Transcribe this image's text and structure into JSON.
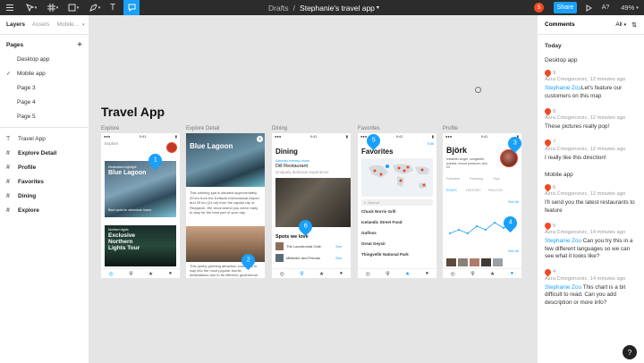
{
  "toolbar": {
    "breadcrumb_parent": "Drafts",
    "breadcrumb_sep": "/",
    "file_name": "Stephanie's travel app",
    "share_label": "Share",
    "zoom": "49%",
    "avatar_initial": "S",
    "ab_label": "A?"
  },
  "left": {
    "tabs": [
      "Layers",
      "Assets",
      "Mobile..."
    ],
    "pages_title": "Pages",
    "pages": [
      "Desktop app",
      "Mobile app",
      "Page 3",
      "Page 4",
      "Page 5"
    ],
    "layers": [
      "Travel App",
      "Explore Detail",
      "Profile",
      "Favorites",
      "Dining",
      "Explore"
    ]
  },
  "canvas": {
    "title": "Travel App",
    "frame_labels": [
      "Explore",
      "Explore Detail",
      "Dining",
      "Favorites",
      "Profile"
    ],
    "explore": {
      "header": "Explore",
      "card1_tag": "Destination highlight",
      "card1_title": "Blue Lagoon",
      "card1_sub": "Best spots for adventure lovers",
      "card2_tag": "Northern lights",
      "card2_title": "Exclusive Northern Lights Tour"
    },
    "detail": {
      "title": "Blue Lagoon",
      "body": "This calming spa is situated approximately 20 km from the Keflavík International Airport and 39 km (24 mi) from the capital city of Reykjavík. We recommend you arrive early to stay for the best part of your day.",
      "body2": "This quirky greeting attraction continues to way into the most popular tourist destinations due to its effective geothermal spa."
    },
    "dining": {
      "title": "Dining",
      "tag": "Saturday evening choice",
      "place": "Dill Restaurant",
      "sub": "Uniquely delicious experience",
      "spots": "Spots we love",
      "item1": "The Laundromat Cafe",
      "item2": "Mikkeller and Friends",
      "see": "See"
    },
    "favorites": {
      "title": "Favorites",
      "edit": "Edit",
      "search": "Search",
      "items": [
        "Chuck Norris Grill",
        "Icelandic Street Food",
        "Gulfoss",
        "Great Geysir",
        "Thingvellir National Park"
      ]
    },
    "profile": {
      "name": "Björk",
      "bio": "Icelandic singer, songwriter, actress, record producer, and DJ",
      "stats": [
        "Followers",
        "Following",
        "Trips"
      ],
      "tabs": [
        "STATS",
        "HISTORY",
        "PHOTOS"
      ],
      "see_all": "See All"
    },
    "markers": [
      "1",
      "2",
      "3",
      "4",
      "5",
      "6"
    ]
  },
  "comments": {
    "header": "Comments",
    "filter": "All",
    "today": "Today",
    "groups": [
      {
        "title": "Desktop app",
        "items": [
          {
            "num": "9",
            "author": "Azra Cmogorcevic",
            "time": "12 minutes ago",
            "mention": "Stephanie Zou",
            "text": "Let's feature our customers on this map"
          },
          {
            "num": "8",
            "author": "Azra Cmogorcevic",
            "time": "12 minutes ago",
            "mention": "",
            "text": "These pictures really pop!"
          },
          {
            "num": "7",
            "author": "Azra Cmogorcevic",
            "time": "12 minutes ago",
            "mention": "",
            "text": "I really like this direction!"
          }
        ]
      },
      {
        "title": "Mobile app",
        "items": [
          {
            "num": "6",
            "author": "Azra Cmogorcevic",
            "time": "12 minutes ago",
            "mention": "",
            "text": "I'll send you the latest restaurants to feature"
          },
          {
            "num": "5",
            "author": "Azra Cmogorcevic",
            "time": "14 minutes ago",
            "mention": "Stephanie Zou",
            "text": "Can you try this in a few different languages so we can see what it looks like?"
          },
          {
            "num": "4",
            "author": "Azra Cmogorcevic",
            "time": "14 minutes ago",
            "mention": "Stephanie Zou",
            "text": "This chart is a bit difficult to read. Can you add description or more info?"
          }
        ]
      }
    ]
  },
  "help": "?"
}
